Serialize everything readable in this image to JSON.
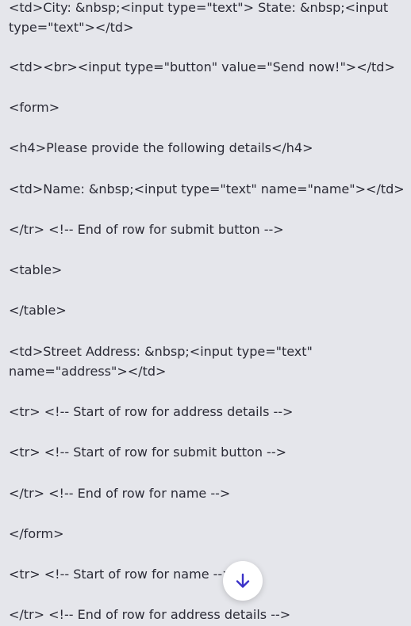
{
  "lines": [
    "<td>City: &nbsp;<input type=\"text\"> State: &nbsp;<input type=\"text\"></td>",
    "<td><br><input type=\"button\" value=\"Send now!\"></td>",
    "<form>",
    "<h4>Please provide the following details</h4>",
    "<td>Name: &nbsp;<input type=\"text\" name=\"name\"></td>",
    "</tr> <!-- End of row for submit button -->",
    "<table>",
    "</table>",
    "<td>Street Address: &nbsp;<input type=\"text\" name=\"address\"></td>",
    "<tr> <!-- Start of row for address details -->",
    "<tr> <!-- Start of row for submit button -->",
    "</tr> <!-- End of row for name -->",
    "</form>",
    "<tr> <!-- Start of row for name -->",
    "</tr> <!-- End of row for address details -->"
  ],
  "scroll_button": {
    "icon": "arrow-down-icon",
    "color": "#3b32c8"
  }
}
